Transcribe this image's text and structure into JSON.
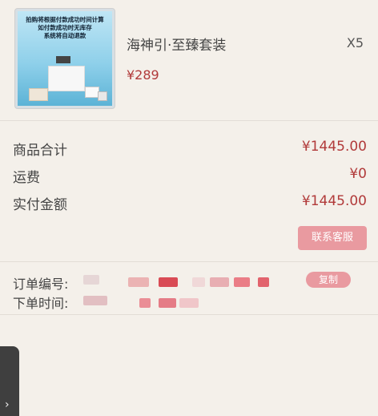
{
  "product": {
    "thumb_lines": [
      "拍购将根据付款成功时间计算",
      "如付款成功时无库存",
      "系统将自动退款"
    ],
    "name": "海神引·至臻套装",
    "price": "¥289",
    "quantity": "X5"
  },
  "summary": {
    "goods_total_label": "商品合计",
    "goods_total_value": "¥1445.00",
    "shipping_label": "运费",
    "shipping_value": "¥0",
    "paid_label": "实付金额",
    "paid_value": "¥1445.00",
    "contact_button": "联系客服"
  },
  "order_info": {
    "order_no_label": "订单编号:",
    "order_time_label": "下单时间:",
    "copy_button": "复制"
  },
  "colors": {
    "accent": "#b13a3a",
    "button": "#e99aa0",
    "background": "#f4f0ea"
  },
  "icons": {
    "side_tab": "chevron-right-icon"
  }
}
